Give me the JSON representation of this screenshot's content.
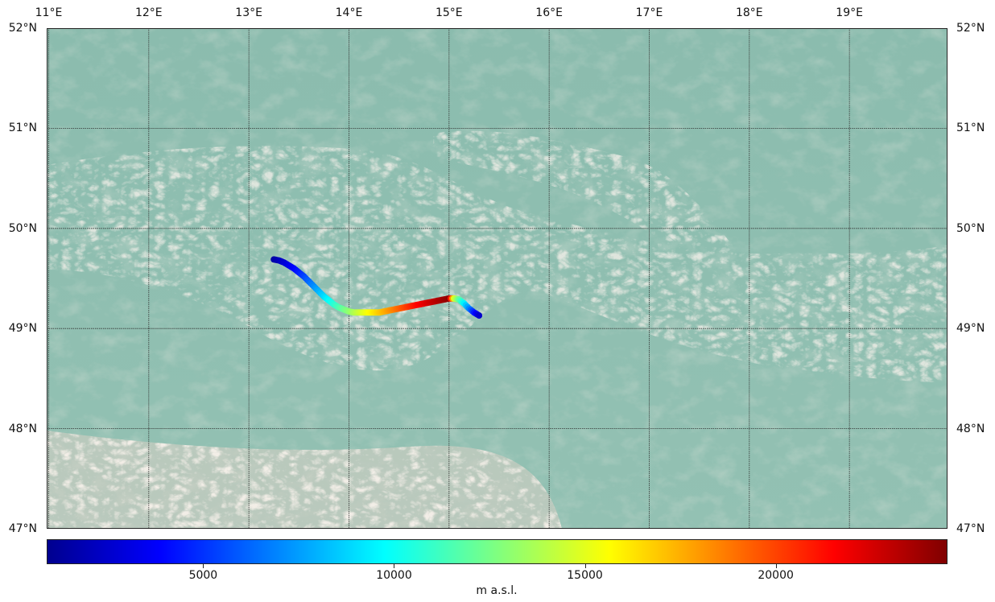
{
  "map": {
    "lon_labels": [
      "11°E",
      "12°E",
      "13°E",
      "14°E",
      "15°E",
      "16°E",
      "17°E",
      "18°E",
      "19°E"
    ],
    "lat_labels": [
      "52°N",
      "51°N",
      "50°N",
      "49°N",
      "48°N",
      "47°N"
    ],
    "extent": {
      "lon_min": 10.98,
      "lon_max": 19.98,
      "lat_min": 47.0,
      "lat_max": 52.0
    },
    "colors": {
      "water_base": "#8fbeb0",
      "relief_light": "#e8d9cc",
      "grid": "#222222"
    }
  },
  "track": {
    "points": [
      [
        13.25,
        49.69,
        1500
      ],
      [
        13.3,
        49.68,
        2000
      ],
      [
        13.35,
        49.66,
        2600
      ],
      [
        13.4,
        49.63,
        3200
      ],
      [
        13.45,
        49.6,
        3800
      ],
      [
        13.5,
        49.56,
        4500
      ],
      [
        13.55,
        49.52,
        5300
      ],
      [
        13.6,
        49.47,
        6200
      ],
      [
        13.65,
        49.42,
        7100
      ],
      [
        13.7,
        49.37,
        8000
      ],
      [
        13.75,
        49.32,
        8900
      ],
      [
        13.8,
        49.28,
        9800
      ],
      [
        13.85,
        49.24,
        10700
      ],
      [
        13.9,
        49.21,
        11500
      ],
      [
        13.95,
        49.19,
        12300
      ],
      [
        14.0,
        49.17,
        13000
      ],
      [
        14.05,
        49.16,
        13700
      ],
      [
        14.1,
        49.16,
        14400
      ],
      [
        14.15,
        49.16,
        15000
      ],
      [
        14.2,
        49.16,
        15600
      ],
      [
        14.25,
        49.16,
        16200
      ],
      [
        14.3,
        49.16,
        16800
      ],
      [
        14.35,
        49.17,
        17400
      ],
      [
        14.4,
        49.18,
        18000
      ],
      [
        14.45,
        49.19,
        18600
      ],
      [
        14.5,
        49.2,
        19200
      ],
      [
        14.55,
        49.21,
        19800
      ],
      [
        14.6,
        49.22,
        20400
      ],
      [
        14.65,
        49.23,
        21000
      ],
      [
        14.7,
        49.24,
        21600
      ],
      [
        14.75,
        49.25,
        22100
      ],
      [
        14.8,
        49.26,
        22600
      ],
      [
        14.85,
        49.27,
        23000
      ],
      [
        14.9,
        49.28,
        23400
      ],
      [
        14.95,
        49.29,
        23800
      ],
      [
        15.0,
        49.3,
        24100
      ],
      [
        15.05,
        49.3,
        15000
      ],
      [
        15.1,
        49.29,
        12000
      ],
      [
        15.15,
        49.25,
        9500
      ],
      [
        15.2,
        49.2,
        7000
      ],
      [
        15.25,
        49.16,
        4500
      ],
      [
        15.3,
        49.13,
        2500
      ]
    ]
  },
  "colorbar": {
    "min": 900,
    "max": 24500,
    "ticks": [
      5000,
      10000,
      15000,
      20000
    ],
    "tick_labels": [
      "5000",
      "10000",
      "15000",
      "20000"
    ],
    "label": "m a.s.l."
  }
}
